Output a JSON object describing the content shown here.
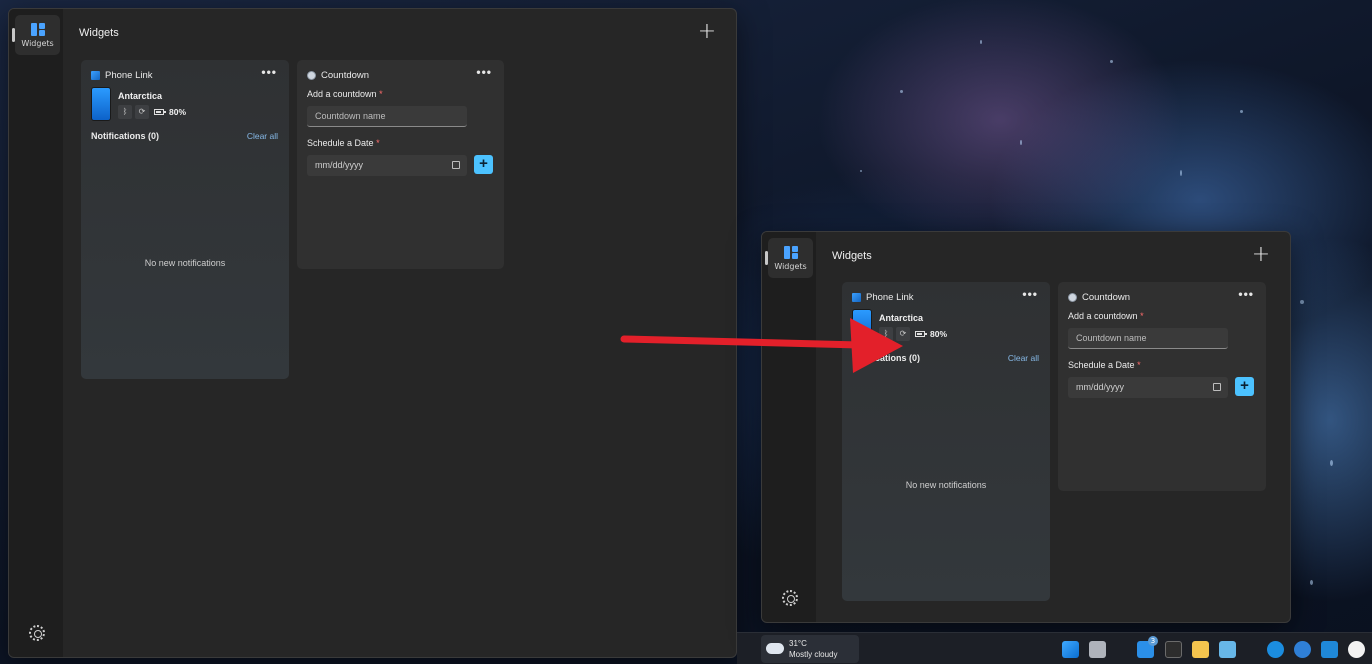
{
  "boards": [
    {
      "rail": {
        "widgets_label": "Widgets"
      },
      "title": "Widgets",
      "phone_link": {
        "app_name": "Phone Link",
        "device_name": "Antarctica",
        "battery": "80%",
        "notifications_title": "Notifications (0)",
        "clear_all": "Clear all",
        "empty_text": "No new notifications"
      },
      "countdown": {
        "app_name": "Countdown",
        "add_label": "Add a countdown",
        "name_placeholder": "Countdown name",
        "date_label": "Schedule a Date",
        "date_placeholder": "mm/dd/yyyy"
      }
    },
    {
      "rail": {
        "widgets_label": "Widgets"
      },
      "title": "Widgets",
      "phone_link": {
        "app_name": "Phone Link",
        "device_name": "Antarctica",
        "battery": "80%",
        "notifications_title": "Notifications (0)",
        "clear_all": "Clear all",
        "empty_text": "No new notifications"
      },
      "countdown": {
        "app_name": "Countdown",
        "add_label": "Add a countdown",
        "name_placeholder": "Countdown name",
        "date_label": "Schedule a Date",
        "date_placeholder": "mm/dd/yyyy"
      }
    }
  ],
  "required_mark": "*",
  "more_glyph": "•••",
  "add_glyph": "+",
  "taskbar": {
    "weather_temp": "31°C",
    "weather_desc": "Mostly cloudy",
    "badge_count": "3"
  },
  "colors": {
    "accent": "#4cc2ff",
    "arrow": "#e3202a",
    "link": "#86b8e6"
  }
}
